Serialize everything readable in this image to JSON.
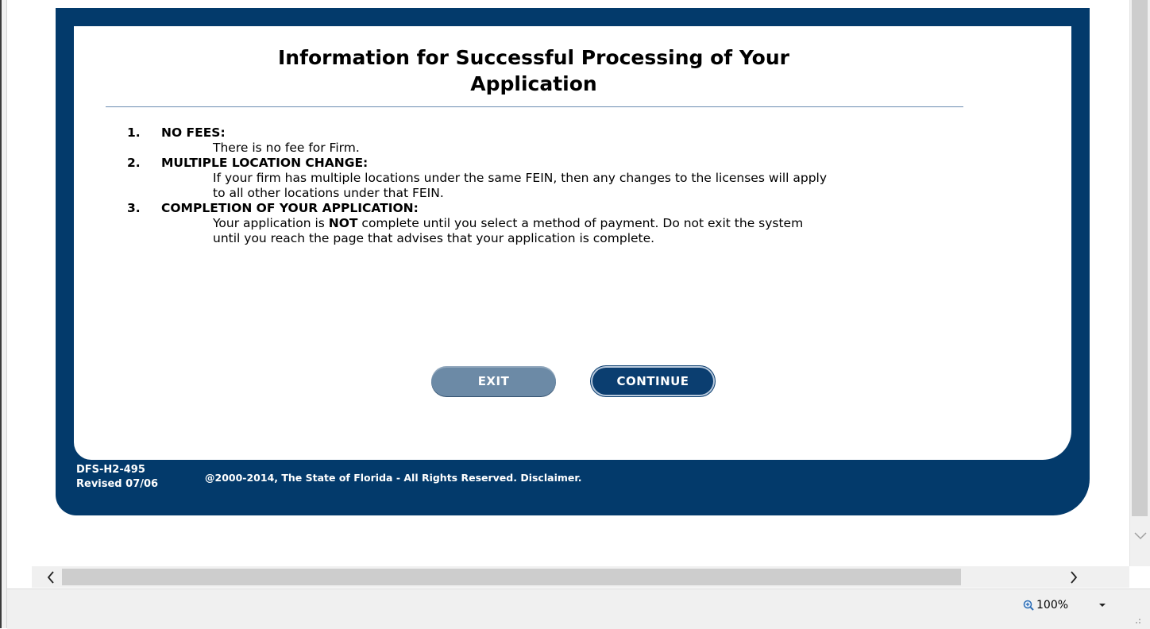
{
  "heading": {
    "line1": "Information for Successful Processing of Your",
    "line2": "Application"
  },
  "items": [
    {
      "number": "1.",
      "title": "NO FEES:",
      "body": "There is no fee for Firm."
    },
    {
      "number": "2.",
      "title": "MULTIPLE LOCATION CHANGE:",
      "body": "If your firm has multiple locations under the same FEIN, then any changes to the licenses will apply to all other locations under that FEIN."
    },
    {
      "number": "3.",
      "title": "COMPLETION OF YOUR APPLICATION:",
      "body_pre": "Your application is ",
      "body_bold": "NOT",
      "body_post": " complete until you select a method of payment. Do not exit the system until you reach the page that advises that your application is complete."
    }
  ],
  "buttons": {
    "exit": "EXIT",
    "continue": "CONTINUE"
  },
  "footer": {
    "form_code": "DFS-H2-495",
    "revised": "Revised 07/06",
    "copyright": "@2000-2014, The State of Florida - All Rights Reserved. Disclaimer."
  },
  "statusbar": {
    "zoom": "100%"
  },
  "icons": {
    "zoom": "zoom-magnifier-icon",
    "zoom_dropdown": "chevron-down-icon",
    "scroll_left": "chevron-left-icon",
    "scroll_right": "chevron-right-icon",
    "scroll_down": "chevron-down-icon",
    "resize_grip": "resize-grip-icon"
  },
  "colors": {
    "frame": "#033a6b",
    "exit_button": "#6c8aa6",
    "continue_button": "#0b3e70"
  }
}
